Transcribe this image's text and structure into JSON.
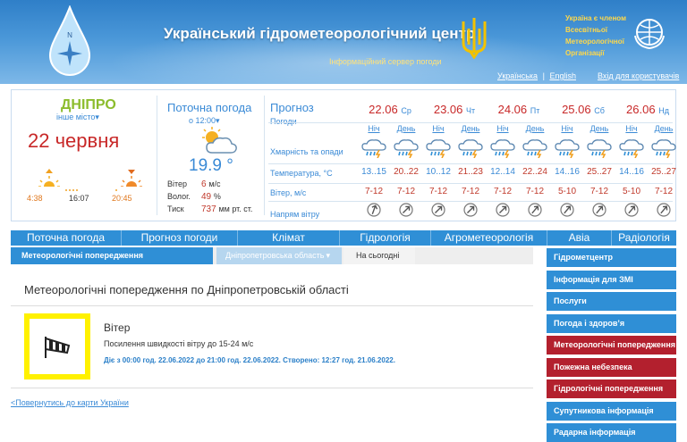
{
  "header": {
    "title": "Український гідрометеорологічний центр",
    "subtitle": "Інформаційний сервер погоди",
    "wmo_line1": "Україна є членом",
    "wmo_line2": "Всесвітньої",
    "wmo_line3": "Метеорологічної",
    "wmo_line4": "Організації",
    "lang_ua": "Українська",
    "lang_sep": "|",
    "lang_en": "English",
    "login": "Вхід для користувачів"
  },
  "location": {
    "city": "ДНІПРО",
    "other_city": "інше місто",
    "date": "22 червня",
    "sunrise": "4:38",
    "day_length": "16:07",
    "sunset": "20:45"
  },
  "current": {
    "title": "Поточна погода",
    "time": "о 12:00",
    "temperature": "19.9 °",
    "wind_label": "Вітер",
    "wind_value": "6",
    "wind_unit": "м/с",
    "humidity_label": "Волог.",
    "humidity_value": "49",
    "humidity_unit": "%",
    "pressure_label": "Тиск",
    "pressure_value": "737",
    "pressure_unit": "мм рт. ст."
  },
  "forecast": {
    "title": "Прогноз",
    "subtitle": "Погоди",
    "row_clouds": "Хмарність та опади",
    "row_temp": "Температура, °С",
    "row_wind": "Вітер, м/с",
    "row_dir": "Напрям вітру",
    "night_label": "Ніч",
    "day_label": "День",
    "days": [
      {
        "date": "22.06",
        "dow": "Ср",
        "t_night": "13..15",
        "t_day": "20..22",
        "w_night": "7-12",
        "w_day": "7-12"
      },
      {
        "date": "23.06",
        "dow": "Чт",
        "t_night": "10..12",
        "t_day": "21..23",
        "w_night": "7-12",
        "w_day": "7-12"
      },
      {
        "date": "24.06",
        "dow": "Пт",
        "t_night": "12..14",
        "t_day": "22..24",
        "w_night": "7-12",
        "w_day": "7-12"
      },
      {
        "date": "25.06",
        "dow": "Сб",
        "t_night": "14..16",
        "t_day": "25..27",
        "w_night": "5-10",
        "w_day": "7-12"
      },
      {
        "date": "26.06",
        "dow": "Нд",
        "t_night": "14..16",
        "t_day": "25..27",
        "w_night": "5-10",
        "w_day": "7-12"
      }
    ]
  },
  "nav": {
    "items": [
      "Поточна погода",
      "Прогноз погоди",
      "Клімат",
      "Гідрологія",
      "Агрометеорологія",
      "Авіа",
      "Радіологія"
    ]
  },
  "subnav": {
    "active": "Метеорологічні попередження",
    "region": "Дніпропетровська область",
    "today": "На сьогодні"
  },
  "content": {
    "title": "Метеорологічні попередження по Дніпропетровській області",
    "warning_title": "Вітер",
    "warning_desc": "Посилення швидкості вітру до 15-24 м/с",
    "warning_period": "Діє з 00:00 год. 22.06.2022 до 21:00 год. 22.06.2022. Створено: 12:27 год. 21.06.2022.",
    "back_link": "<Повернутись до карти України"
  },
  "side_menu": [
    {
      "label": "Гідрометцентр",
      "color": "blue"
    },
    {
      "label": "Інформація для ЗМІ",
      "color": "blue"
    },
    {
      "label": "Послуги",
      "color": "blue"
    },
    {
      "label": "Погода і здоров’я",
      "color": "blue"
    },
    {
      "label": "Метеорологічні попередження",
      "color": "red"
    },
    {
      "label": "Пожежна небезпека",
      "color": "red"
    },
    {
      "label": "Гідрологічні попередження",
      "color": "red"
    },
    {
      "label": "Супутникова інформація",
      "color": "blue"
    },
    {
      "label": "Радарна інформація",
      "color": "blue"
    }
  ],
  "colors": {
    "accent": "#2f8fd6",
    "warning_red": "#b3202e",
    "warning_yellow": "#fff100",
    "date_red": "#c82828"
  }
}
